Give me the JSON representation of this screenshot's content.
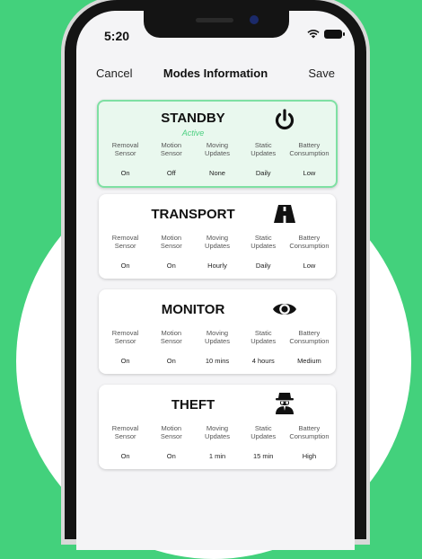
{
  "status_bar": {
    "time": "5:20"
  },
  "nav": {
    "cancel": "Cancel",
    "title": "Modes Information",
    "save": "Save"
  },
  "modes": [
    {
      "title": "STANDBY",
      "status": "Active",
      "icon": "power-icon",
      "columns": [
        {
          "head1": "Removal",
          "head2": "Sensor",
          "value": "On"
        },
        {
          "head1": "Motion",
          "head2": "Sensor",
          "value": "Off"
        },
        {
          "head1": "Moving",
          "head2": "Updates",
          "value": "None"
        },
        {
          "head1": "Static",
          "head2": "Updates",
          "value": "Daily"
        },
        {
          "head1": "Battery",
          "head2": "Consumption",
          "value": "Low"
        }
      ]
    },
    {
      "title": "TRANSPORT",
      "icon": "road-icon",
      "columns": [
        {
          "head1": "Removal",
          "head2": "Sensor",
          "value": "On"
        },
        {
          "head1": "Motion",
          "head2": "Sensor",
          "value": "On"
        },
        {
          "head1": "Moving",
          "head2": "Updates",
          "value": "Hourly"
        },
        {
          "head1": "Static",
          "head2": "Updates",
          "value": "Daily"
        },
        {
          "head1": "Battery",
          "head2": "Consumption",
          "value": "Low"
        }
      ]
    },
    {
      "title": "MONITOR",
      "icon": "eye-icon",
      "columns": [
        {
          "head1": "Removal",
          "head2": "Sensor",
          "value": "On"
        },
        {
          "head1": "Motion",
          "head2": "Sensor",
          "value": "On"
        },
        {
          "head1": "Moving",
          "head2": "Updates",
          "value": "10 mins"
        },
        {
          "head1": "Static",
          "head2": "Updates",
          "value": "4 hours"
        },
        {
          "head1": "Battery",
          "head2": "Consumption",
          "value": "Medium"
        }
      ]
    },
    {
      "title": "THEFT",
      "icon": "spy-icon",
      "columns": [
        {
          "head1": "Removal",
          "head2": "Sensor",
          "value": "On"
        },
        {
          "head1": "Motion",
          "head2": "Sensor",
          "value": "On"
        },
        {
          "head1": "Moving",
          "head2": "Updates",
          "value": "1 min"
        },
        {
          "head1": "Static",
          "head2": "Updates",
          "value": "15 min"
        },
        {
          "head1": "Battery",
          "head2": "Consumption",
          "value": "High"
        }
      ]
    }
  ],
  "colors": {
    "background": "#43d17c",
    "active_card": "#e9f8ee",
    "active_border": "#7fe0a3",
    "active_text": "#4cd081"
  }
}
